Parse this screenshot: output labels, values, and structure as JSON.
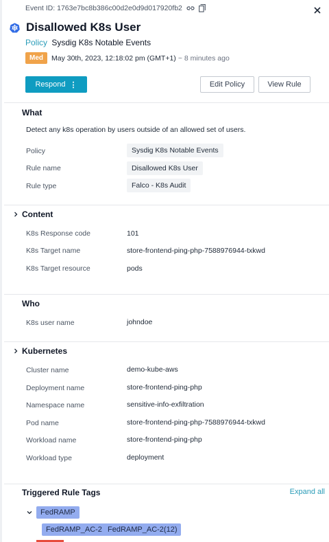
{
  "header": {
    "event_id": "Event ID: 1763e7bc8b386c00d2e0d9d017920fb2",
    "title": "Disallowed K8s User",
    "policy_label": "Policy",
    "policy_name": "Sysdig K8s Notable Events",
    "severity": "Med",
    "timestamp": "May 30th, 2023, 12:18:02 pm (GMT+1)",
    "relative_time": "~ 8 minutes ago"
  },
  "actions": {
    "respond": "Respond",
    "respond_more": "⋮",
    "edit_policy": "Edit Policy",
    "view_rule": "View Rule"
  },
  "what": {
    "heading": "What",
    "description": "Detect any k8s operation by users outside of an allowed set of users.",
    "rows": [
      {
        "label": "Policy",
        "value": "Sysdig K8s Notable Events"
      },
      {
        "label": "Rule name",
        "value": "Disallowed K8s User"
      },
      {
        "label": "Rule type",
        "value": "Falco - K8s Audit"
      }
    ]
  },
  "content": {
    "heading": "Content",
    "rows": [
      {
        "label": "K8s Response code",
        "value": "101"
      },
      {
        "label": "K8s Target name",
        "value": "store-frontend-ping-php-7588976944-txkwd"
      },
      {
        "label": "K8s Target resource",
        "value": "pods"
      }
    ]
  },
  "who": {
    "heading": "Who",
    "rows": [
      {
        "label": "K8s user name",
        "value": "johndoe"
      }
    ]
  },
  "kubernetes": {
    "heading": "Kubernetes",
    "rows": [
      {
        "label": "Cluster name",
        "value": "demo-kube-aws"
      },
      {
        "label": "Deployment name",
        "value": "store-frontend-ping-php"
      },
      {
        "label": "Namespace name",
        "value": "sensitive-info-exfiltration"
      },
      {
        "label": "Pod name",
        "value": "store-frontend-ping-php-7588976944-txkwd"
      },
      {
        "label": "Workload name",
        "value": "store-frontend-ping-php"
      },
      {
        "label": "Workload type",
        "value": "deployment"
      }
    ]
  },
  "tags": {
    "heading": "Triggered Rule Tags",
    "expand_all": "Expand all",
    "group": "FedRAMP",
    "items": [
      "FedRAMP_AC-2",
      "FedRAMP_AC-2(12)"
    ]
  },
  "icons": {
    "copy_link": "link-icon",
    "copy": "copy-icon",
    "close": "close-icon",
    "kubernetes": "kubernetes-icon"
  },
  "colors": {
    "accent": "#0f9cc1",
    "link": "#2a9cb8",
    "severity_med": "#f0a34a",
    "tag": "#93acef"
  }
}
